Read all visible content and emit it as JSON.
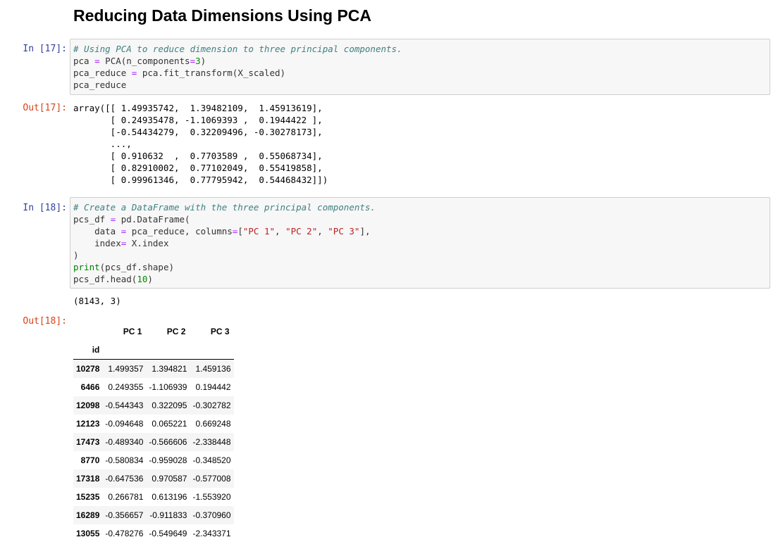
{
  "heading": "Reducing Data Dimensions Using PCA",
  "cell17": {
    "in_prompt": "In [17]:",
    "out_prompt": "Out[17]:",
    "code": {
      "l1": "# Using PCA to reduce dimension to three principal components.",
      "l2a": "pca ",
      "l2b": "=",
      "l2c": " PCA(n_components",
      "l2d": "=",
      "l2e": "3",
      "l2f": ")",
      "l3a": "pca_reduce ",
      "l3b": "=",
      "l3c": " pca.fit_transform(X_scaled)",
      "l4": "pca_reduce"
    },
    "output": [
      "array([[ 1.49935742,  1.39482109,  1.45913619],",
      "       [ 0.24935478, -1.1069393 ,  0.1944422 ],",
      "       [-0.54434279,  0.32209496, -0.30278173],",
      "       ...,",
      "       [ 0.910632  ,  0.7703589 ,  0.55068734],",
      "       [ 0.82910002,  0.77102049,  0.55419858],",
      "       [ 0.99961346,  0.77795942,  0.54468432]])"
    ]
  },
  "cell18": {
    "in_prompt": "In [18]:",
    "out_prompt": "Out[18]:",
    "code": {
      "l1": "# Create a DataFrame with the three principal components.",
      "l2a": "pcs_df ",
      "l2b": "=",
      "l2c": " pd.DataFrame(",
      "l3a": "    data ",
      "l3b": "=",
      "l3c": " pca_reduce, columns",
      "l3d": "=",
      "l3e": "[",
      "l3f": "\"PC 1\"",
      "l3g": ", ",
      "l3h": "\"PC 2\"",
      "l3i": ", ",
      "l3j": "\"PC 3\"",
      "l3k": "],",
      "l4a": "    index",
      "l4b": "=",
      "l4c": " X.index",
      "l5": ")",
      "l6a": "print",
      "l6b": "(pcs_df.shape)",
      "l7a": "pcs_df.head(",
      "l7b": "10",
      "l7c": ")"
    },
    "stdout": "(8143, 3)",
    "table": {
      "columns": [
        "PC 1",
        "PC 2",
        "PC 3"
      ],
      "index_name": "id",
      "rows": [
        {
          "id": "10278",
          "v": [
            "1.499357",
            "1.394821",
            "1.459136"
          ]
        },
        {
          "id": "6466",
          "v": [
            "0.249355",
            "-1.106939",
            "0.194442"
          ]
        },
        {
          "id": "12098",
          "v": [
            "-0.544343",
            "0.322095",
            "-0.302782"
          ]
        },
        {
          "id": "12123",
          "v": [
            "-0.094648",
            "0.065221",
            "0.669248"
          ]
        },
        {
          "id": "17473",
          "v": [
            "-0.489340",
            "-0.566606",
            "-2.338448"
          ]
        },
        {
          "id": "8770",
          "v": [
            "-0.580834",
            "-0.959028",
            "-0.348520"
          ]
        },
        {
          "id": "17318",
          "v": [
            "-0.647536",
            "0.970587",
            "-0.577008"
          ]
        },
        {
          "id": "15235",
          "v": [
            "0.266781",
            "0.613196",
            "-1.553920"
          ]
        },
        {
          "id": "16289",
          "v": [
            "-0.356657",
            "-0.911833",
            "-0.370960"
          ]
        },
        {
          "id": "13055",
          "v": [
            "-0.478276",
            "-0.549649",
            "-2.343371"
          ]
        }
      ]
    }
  }
}
